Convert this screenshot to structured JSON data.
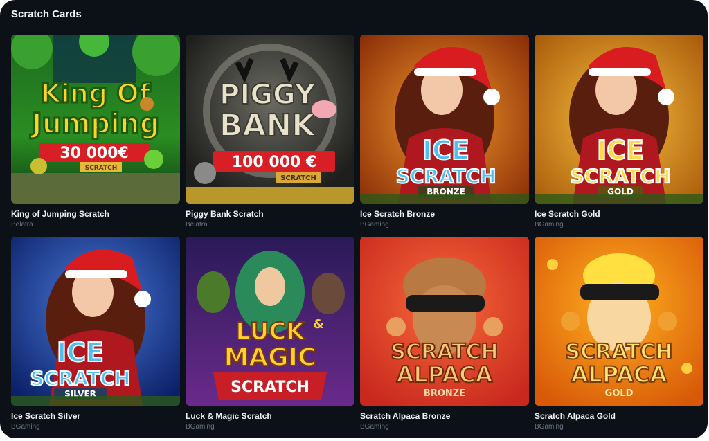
{
  "section": {
    "title": "Scratch Cards"
  },
  "cards": [
    {
      "title": "King of Jumping Scratch",
      "provider": "Belatra",
      "art": {
        "line1": "King Of",
        "line2": "Jumping",
        "prize": "30 000€",
        "tag": "SCRATCH"
      }
    },
    {
      "title": "Piggy Bank Scratch",
      "provider": "Belatra",
      "art": {
        "line1": "PIGGY",
        "line2": "BANK",
        "prize": "100 000 €",
        "tag": "SCRATCH"
      }
    },
    {
      "title": "Ice Scratch Bronze",
      "provider": "BGaming",
      "art": {
        "line1": "ICE",
        "line2": "SCRATCH",
        "tier": "BRONZE"
      }
    },
    {
      "title": "Ice Scratch Gold",
      "provider": "BGaming",
      "art": {
        "line1": "ICE",
        "line2": "SCRATCH",
        "tier": "GOLD"
      }
    },
    {
      "title": "Ice Scratch Silver",
      "provider": "BGaming",
      "art": {
        "line1": "ICE",
        "line2": "SCRATCH",
        "tier": "SILVER"
      }
    },
    {
      "title": "Luck & Magic Scratch",
      "provider": "BGaming",
      "art": {
        "line1": "LUCK",
        "amp": "&",
        "line2": "MAGIC",
        "tag": "SCRATCH"
      }
    },
    {
      "title": "Scratch Alpaca Bronze",
      "provider": "BGaming",
      "art": {
        "line1": "SCRATCH",
        "line2": "ALPACA",
        "tier": "BRONZE"
      }
    },
    {
      "title": "Scratch Alpaca Gold",
      "provider": "BGaming",
      "art": {
        "line1": "SCRATCH",
        "line2": "ALPACA",
        "tier": "GOLD"
      }
    }
  ],
  "colors": {
    "panel_bg": "#0c1118",
    "title_text": "#f0f2f5",
    "provider_text": "#6c7685",
    "prize_red": "#d81f26",
    "ice_blue": "#3fb4f0",
    "alpaca_orange": "#f07a1a"
  }
}
